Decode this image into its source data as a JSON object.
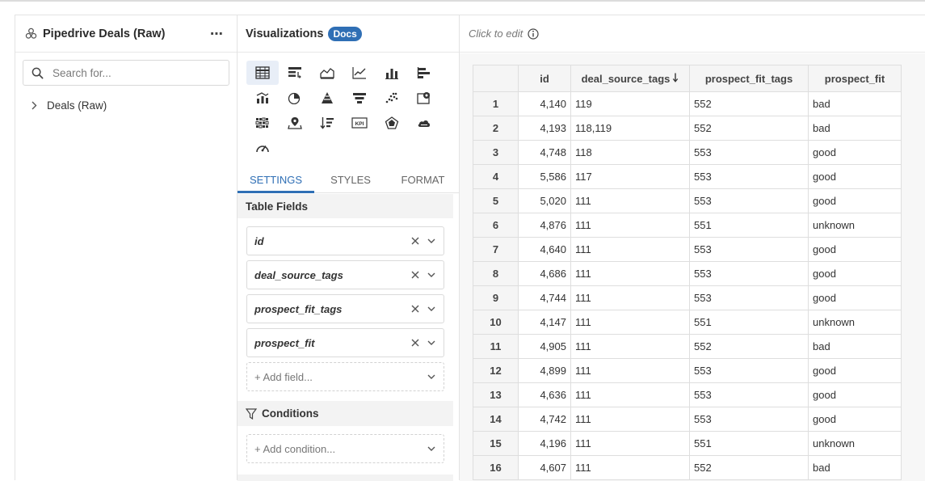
{
  "left_panel": {
    "title": "Pipedrive Deals (Raw)",
    "more_label": "⋯",
    "search_placeholder": "Search for...",
    "tree_items": [
      {
        "label": "Deals (Raw)"
      }
    ]
  },
  "mid_panel": {
    "title": "Visualizations",
    "docs_label": "Docs",
    "viz_icons": [
      "table-icon",
      "pivot-table-icon",
      "area-chart-icon",
      "line-chart-icon",
      "bar-chart-icon",
      "horizontal-bar-chart-icon",
      "combo-chart-icon",
      "pie-chart-icon",
      "pyramid-chart-icon",
      "funnel-chart-icon",
      "scatter-chart-icon",
      "map-pin-icon",
      "heatmap-icon",
      "geo-map-icon",
      "sorted-list-icon",
      "kpi-icon",
      "radar-chart-icon",
      "word-cloud-icon",
      "gauge-icon"
    ],
    "kpi_text": "KPI",
    "tabs": [
      "SETTINGS",
      "STYLES",
      "FORMAT"
    ],
    "table_fields_title": "Table Fields",
    "fields": [
      "id",
      "deal_source_tags",
      "prospect_fit_tags",
      "prospect_fit"
    ],
    "add_field_label": "+ Add field...",
    "conditions_title": "Conditions",
    "add_condition_label": "+ Add condition..."
  },
  "right_panel": {
    "click_to_edit": "Click to edit",
    "table": {
      "columns": [
        "id",
        "deal_source_tags",
        "prospect_fit_tags",
        "prospect_fit"
      ],
      "sorted_column": "deal_source_tags",
      "sort_direction": "descending",
      "rows": [
        [
          "1",
          "4,140",
          "119",
          "552",
          "bad"
        ],
        [
          "2",
          "4,193",
          "118,119",
          "552",
          "bad"
        ],
        [
          "3",
          "4,748",
          "118",
          "553",
          "good"
        ],
        [
          "4",
          "5,586",
          "117",
          "553",
          "good"
        ],
        [
          "5",
          "5,020",
          "111",
          "553",
          "good"
        ],
        [
          "6",
          "4,876",
          "111",
          "551",
          "unknown"
        ],
        [
          "7",
          "4,640",
          "111",
          "553",
          "good"
        ],
        [
          "8",
          "4,686",
          "111",
          "553",
          "good"
        ],
        [
          "9",
          "4,744",
          "111",
          "553",
          "good"
        ],
        [
          "10",
          "4,147",
          "111",
          "551",
          "unknown"
        ],
        [
          "11",
          "4,905",
          "111",
          "552",
          "bad"
        ],
        [
          "12",
          "4,899",
          "111",
          "553",
          "good"
        ],
        [
          "13",
          "4,636",
          "111",
          "553",
          "good"
        ],
        [
          "14",
          "4,742",
          "111",
          "553",
          "good"
        ],
        [
          "15",
          "4,196",
          "111",
          "551",
          "unknown"
        ],
        [
          "16",
          "4,607",
          "111",
          "552",
          "bad"
        ]
      ]
    }
  },
  "colors": {
    "accent": "#2f6fb5",
    "border": "#dedede",
    "panel_bg": "#f3f3f3"
  }
}
